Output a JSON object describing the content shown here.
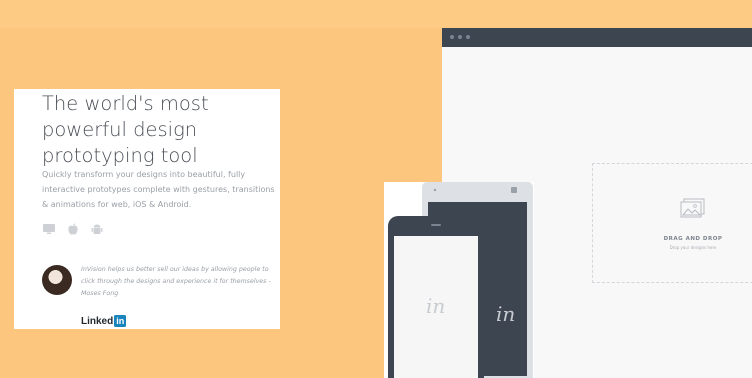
{
  "hero": {
    "headline": "The world's most powerful design prototyping tool",
    "description": "Quickly transform your designs into beautiful, fully interactive prototypes complete with gestures, transitions & animations for web, iOS & Android.",
    "platforms": [
      "monitor-icon",
      "apple-icon",
      "android-icon"
    ],
    "testimonial": "InVision helps us better sell our ideas by allowing people to click through the designs and experience it for themselves - Moses Fong",
    "company": "Linked",
    "company_box": "in"
  },
  "dropzone": {
    "label": "DRAG AND DROP",
    "sublabel": "Drop your designs here"
  },
  "devices": {
    "phone_logo": "in",
    "tablet_logo": "in"
  },
  "colors": {
    "background": "#fdc67f",
    "browser_bar": "#3d4551",
    "linkedin": "#1a84bc"
  }
}
